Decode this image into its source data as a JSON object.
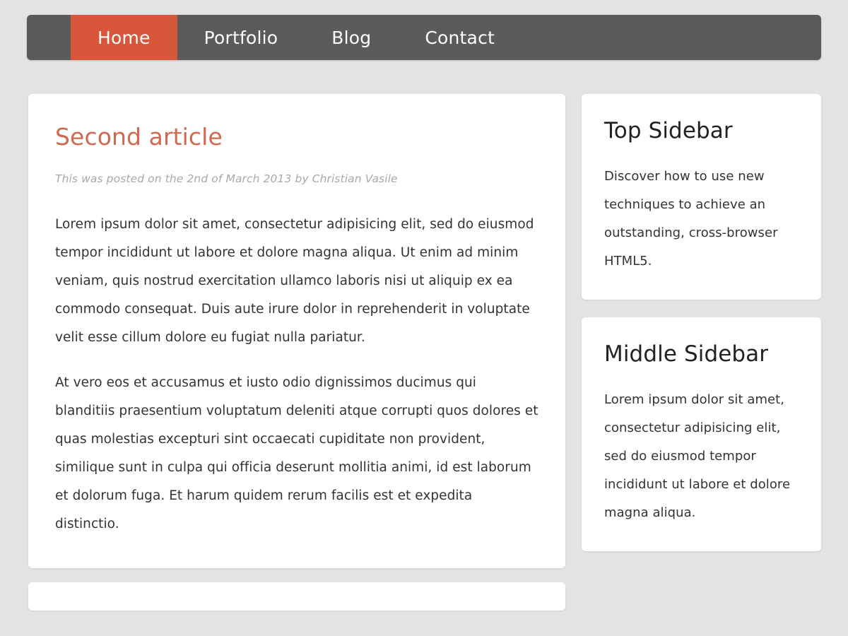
{
  "theme": {
    "page_background": "#e3e3e3",
    "nav_background": "#5b5b5b",
    "nav_active_background": "#d8573a",
    "nav_text_color": "#ffffff",
    "card_background": "#ffffff",
    "accent_color": "#d2694f",
    "body_text_color": "#333333",
    "meta_text_color": "#a9a9a9"
  },
  "nav": {
    "items": [
      {
        "label": "Home",
        "active": true
      },
      {
        "label": "Portfolio",
        "active": false
      },
      {
        "label": "Blog",
        "active": false
      },
      {
        "label": "Contact",
        "active": false
      }
    ]
  },
  "article": {
    "title": "Second article",
    "meta": "This was posted on the 2nd of March 2013 by Christian Vasile",
    "paragraphs": [
      "Lorem ipsum dolor sit amet, consectetur adipisicing elit, sed do eiusmod tempor incididunt ut labore et dolore magna aliqua. Ut enim ad minim veniam, quis nostrud exercitation ullamco laboris nisi ut aliquip ex ea commodo consequat. Duis aute irure dolor in reprehenderit in voluptate velit esse cillum dolore eu fugiat nulla pariatur.",
      "At vero eos et accusamus et iusto odio dignissimos ducimus qui blanditiis praesentium voluptatum deleniti atque corrupti quos dolores et quas molestias excepturi sint occaecati cupiditate non provident, similique sunt in culpa qui officia deserunt mollitia animi, id est laborum et dolorum fuga. Et harum quidem rerum facilis est et expedita distinctio."
    ]
  },
  "sidebar": {
    "widgets": [
      {
        "title": "Top Sidebar",
        "body": "Discover how to use new techniques to achieve an outstanding, cross-browser HTML5."
      },
      {
        "title": "Middle Sidebar",
        "body": "Lorem ipsum dolor sit amet, consectetur adipisicing elit, sed do eiusmod tempor incididunt ut labore et dolore magna aliqua."
      }
    ]
  }
}
